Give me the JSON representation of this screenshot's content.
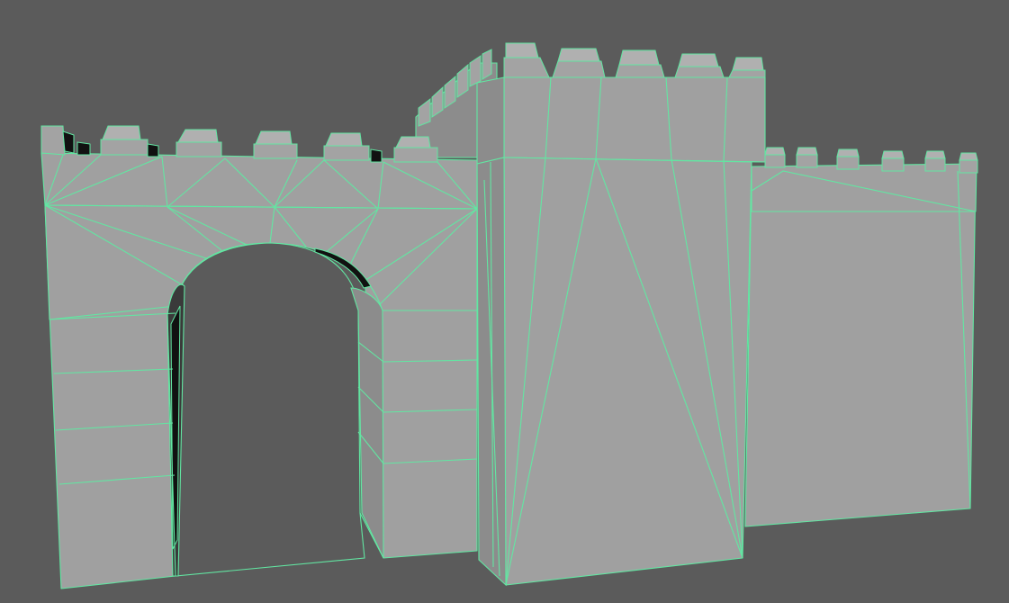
{
  "viewport": {
    "background_color": "#5b5b5b",
    "wireframe_color": "#62e6a2",
    "surface_color": "#a0a0a0",
    "shading_mode": "wireframe-on-shaded"
  },
  "scene": {
    "objects": [
      "gate-wall-with-arch",
      "central-tower",
      "right-curtain-wall",
      "rear-battlements"
    ]
  }
}
